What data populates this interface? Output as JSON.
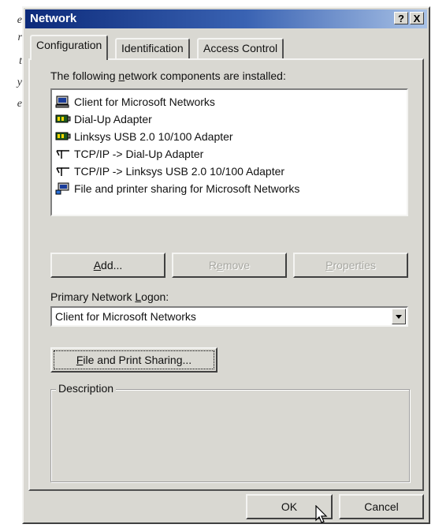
{
  "margin_text": [
    "e",
    "r",
    "t",
    "y",
    "e"
  ],
  "window": {
    "title": "Network",
    "help_button": "?",
    "close_button": "X"
  },
  "tabs": [
    {
      "label": "Configuration",
      "active": true
    },
    {
      "label": "Identification",
      "active": false
    },
    {
      "label": "Access Control",
      "active": false
    }
  ],
  "components": {
    "label_pre": "The following ",
    "label_accel": "n",
    "label_post": "etwork components are installed:",
    "items": [
      {
        "icon": "client-icon",
        "label": "Client for Microsoft Networks"
      },
      {
        "icon": "adapter-icon",
        "label": "Dial-Up Adapter"
      },
      {
        "icon": "adapter-icon",
        "label": "Linksys USB 2.0 10/100 Adapter"
      },
      {
        "icon": "protocol-icon",
        "label": "TCP/IP -> Dial-Up Adapter"
      },
      {
        "icon": "protocol-icon",
        "label": "TCP/IP -> Linksys USB 2.0 10/100 Adapter"
      },
      {
        "icon": "service-icon",
        "label": "File and printer sharing for Microsoft Networks"
      }
    ]
  },
  "buttons": {
    "add_accel": "A",
    "add_rest": "dd...",
    "remove_pre": "R",
    "remove_accel": "e",
    "remove_post": "move",
    "properties_accel": "P",
    "properties_rest": "roperties"
  },
  "logon": {
    "label_pre": "Primary Network ",
    "label_accel": "L",
    "label_post": "ogon:",
    "value": "Client for Microsoft Networks"
  },
  "sharing_button": {
    "accel": "F",
    "rest": "ile and Print Sharing..."
  },
  "description": {
    "legend": "Description"
  },
  "footer": {
    "ok": "OK",
    "cancel": "Cancel"
  },
  "colors": {
    "face": "#d9d8d2",
    "title_start": "#0c2a7a",
    "title_end": "#a9c2e6"
  }
}
